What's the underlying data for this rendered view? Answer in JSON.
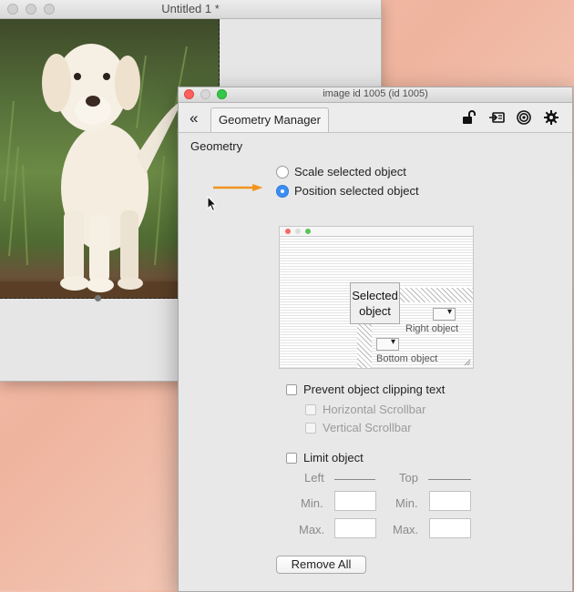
{
  "background_window": {
    "title": "Untitled 1 *"
  },
  "window": {
    "title": "image id 1005 (id 1005)",
    "toolbar": {
      "back_icon": "double-chevron-left-icon",
      "tab_label": "Geometry Manager",
      "icons": [
        "unlock-icon",
        "message-icon",
        "target-icon",
        "gear-icon"
      ]
    },
    "section_title": "Geometry",
    "mode_options": [
      {
        "label": "Scale selected object",
        "selected": false
      },
      {
        "label": "Position selected object",
        "selected": true
      }
    ],
    "diagram": {
      "selected_label_line1": "Selected",
      "selected_label_line2": "object",
      "right_label": "Right object",
      "bottom_label": "Bottom object"
    },
    "prevent_clipping": {
      "label": "Prevent object clipping text",
      "checked": false,
      "sub_options": [
        {
          "label": "Horizontal Scrollbar",
          "checked": false,
          "enabled": false
        },
        {
          "label": "Vertical Scrollbar",
          "checked": false,
          "enabled": false
        }
      ]
    },
    "limit_object": {
      "label": "Limit object",
      "checked": false,
      "left_heading": "Left",
      "top_heading": "Top",
      "min_label": "Min.",
      "max_label": "Max.",
      "left_min": "",
      "left_max": "",
      "top_min": "",
      "top_max": ""
    },
    "remove_all_label": "Remove All"
  },
  "colors": {
    "accent_blue": "#3b8ef5",
    "arrow_orange": "#f2941f",
    "close_red": "#fc605c",
    "zoom_green": "#34c84a"
  }
}
